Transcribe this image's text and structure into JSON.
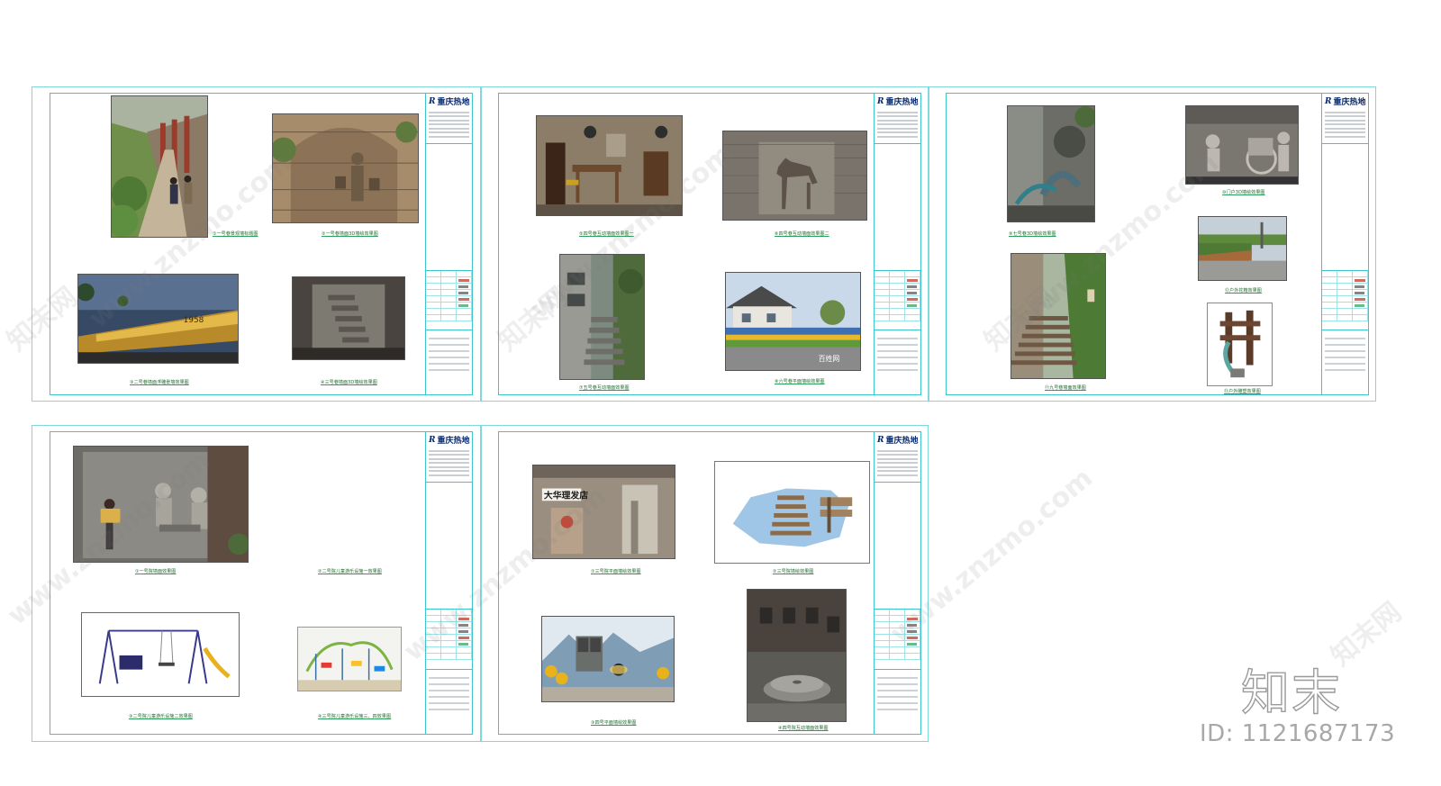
{
  "sheets": [
    {
      "company_logo": "重庆热地",
      "captions": [
        "①一号巷景观墙标题图",
        "②一号巷墙面3D墙绘效果图",
        "③二号巷墙面浮雕景墙效果图",
        "④三号巷墙面3D墙绘效果图"
      ]
    },
    {
      "company_logo": "重庆热地",
      "captions": [
        "⑤四号巷互动墙面效果图一",
        "⑥四号巷互动墙面效果图二",
        "⑦五号巷互动墙面效果图",
        "⑧六号巷平面墙绘效果图"
      ]
    },
    {
      "company_logo": "重庆热地",
      "captions": [
        "⑨七号巷3D墙绘效果图",
        "⑩门户3D墙绘效果图",
        "⑪九号巷墙面效果图",
        "⑫户外花箱效果图",
        "⑬户外雕塑效果图"
      ]
    },
    {
      "company_logo": "重庆热地",
      "captions": [
        "①一号院墙面效果图",
        "②二号院儿童游乐设施一效果图",
        "③二号院儿童游乐设施二效果图",
        "④三号院儿童游乐设施三、四效果图"
      ]
    },
    {
      "company_logo": "重庆热地",
      "captions": [
        "①三号院平面墙绘效果图",
        "②三号院墙绘效果图",
        "③四号平面墙绘效果图",
        "④四号院互动墙面效果图"
      ]
    }
  ],
  "photo_labels": {
    "barbershop_sign": "大华理发店",
    "year_marker": "1958",
    "photo_watermark": "百姓网"
  },
  "watermarks": {
    "site": "www.znzmo.com",
    "brand_cn": "知末网",
    "logo": "知末",
    "id_text": "ID: 1121687173"
  }
}
